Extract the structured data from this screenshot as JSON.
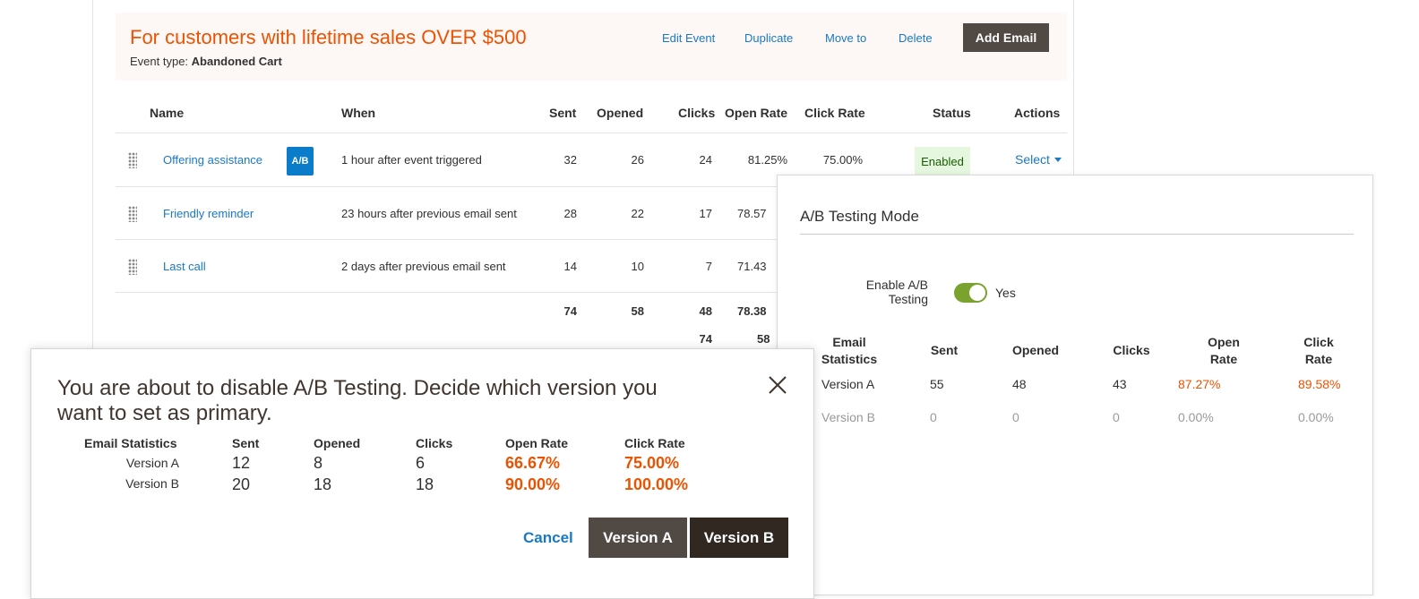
{
  "event": {
    "title": "For customers with lifetime sales OVER $500",
    "type_label": "Event type:",
    "type_value": "Abandoned Cart",
    "links": {
      "edit": "Edit Event",
      "duplicate": "Duplicate",
      "move": "Move to",
      "delete": "Delete"
    },
    "add_email_label": "Add Email"
  },
  "table": {
    "columns": {
      "name": "Name",
      "when": "When",
      "sent": "Sent",
      "opened": "Opened",
      "clicks": "Clicks",
      "open_rate": "Open Rate",
      "click_rate": "Click Rate",
      "status": "Status",
      "actions": "Actions"
    },
    "rows": [
      {
        "name": "Offering assistance",
        "badge": "A/B",
        "when": "1 hour after event triggered",
        "sent": "32",
        "opened": "26",
        "clicks": "24",
        "open_rate": "81.25%",
        "click_rate": "75.00%",
        "status": "Enabled",
        "action": "Select"
      },
      {
        "name": "Friendly reminder",
        "when": "23 hours after previous email sent",
        "sent": "28",
        "opened": "22",
        "clicks": "17",
        "open_rate": "78.57"
      },
      {
        "name": "Last call",
        "when": "2 days after previous email sent",
        "sent": "14",
        "opened": "10",
        "clicks": "7",
        "open_rate": "71.43"
      }
    ],
    "totals": {
      "sent": "74",
      "opened": "58",
      "clicks": "48",
      "open_rate": "78.38"
    },
    "subtotals": {
      "clicks": "74",
      "open_rate": "58"
    }
  },
  "ab_panel": {
    "title": "A/B Testing Mode",
    "toggle_label": "Enable A/B Testing",
    "toggle_value": "Yes",
    "columns": {
      "stats": "Email Statistics",
      "sent": "Sent",
      "opened": "Opened",
      "clicks": "Clicks",
      "open_rate": "Open Rate",
      "click_rate": "Click Rate"
    },
    "rows": [
      {
        "version": "Version A",
        "sent": "55",
        "opened": "48",
        "clicks": "43",
        "open_rate": "87.27%",
        "click_rate": "89.58%"
      },
      {
        "version": "Version B",
        "sent": "0",
        "opened": "0",
        "clicks": "0",
        "open_rate": "0.00%",
        "click_rate": "0.00%"
      }
    ]
  },
  "modal": {
    "title": "You are about to disable A/B Testing. Decide which version you want to set as primary.",
    "columns": {
      "stats": "Email Statistics",
      "sent": "Sent",
      "opened": "Opened",
      "clicks": "Clicks",
      "open_rate": "Open Rate",
      "click_rate": "Click Rate"
    },
    "rows": [
      {
        "version": "Version A",
        "sent": "12",
        "opened": "8",
        "clicks": "6",
        "open_rate": "66.67%",
        "click_rate": "75.00%"
      },
      {
        "version": "Version B",
        "sent": "20",
        "opened": "18",
        "clicks": "18",
        "open_rate": "90.00%",
        "click_rate": "100.00%"
      }
    ],
    "cancel_label": "Cancel",
    "version_a_label": "Version A",
    "version_b_label": "Version B"
  },
  "colors": {
    "accent_orange": "#eb5202",
    "link_blue": "#1979c3",
    "button_dark": "#514943",
    "toggle_on": "#79a22e"
  }
}
